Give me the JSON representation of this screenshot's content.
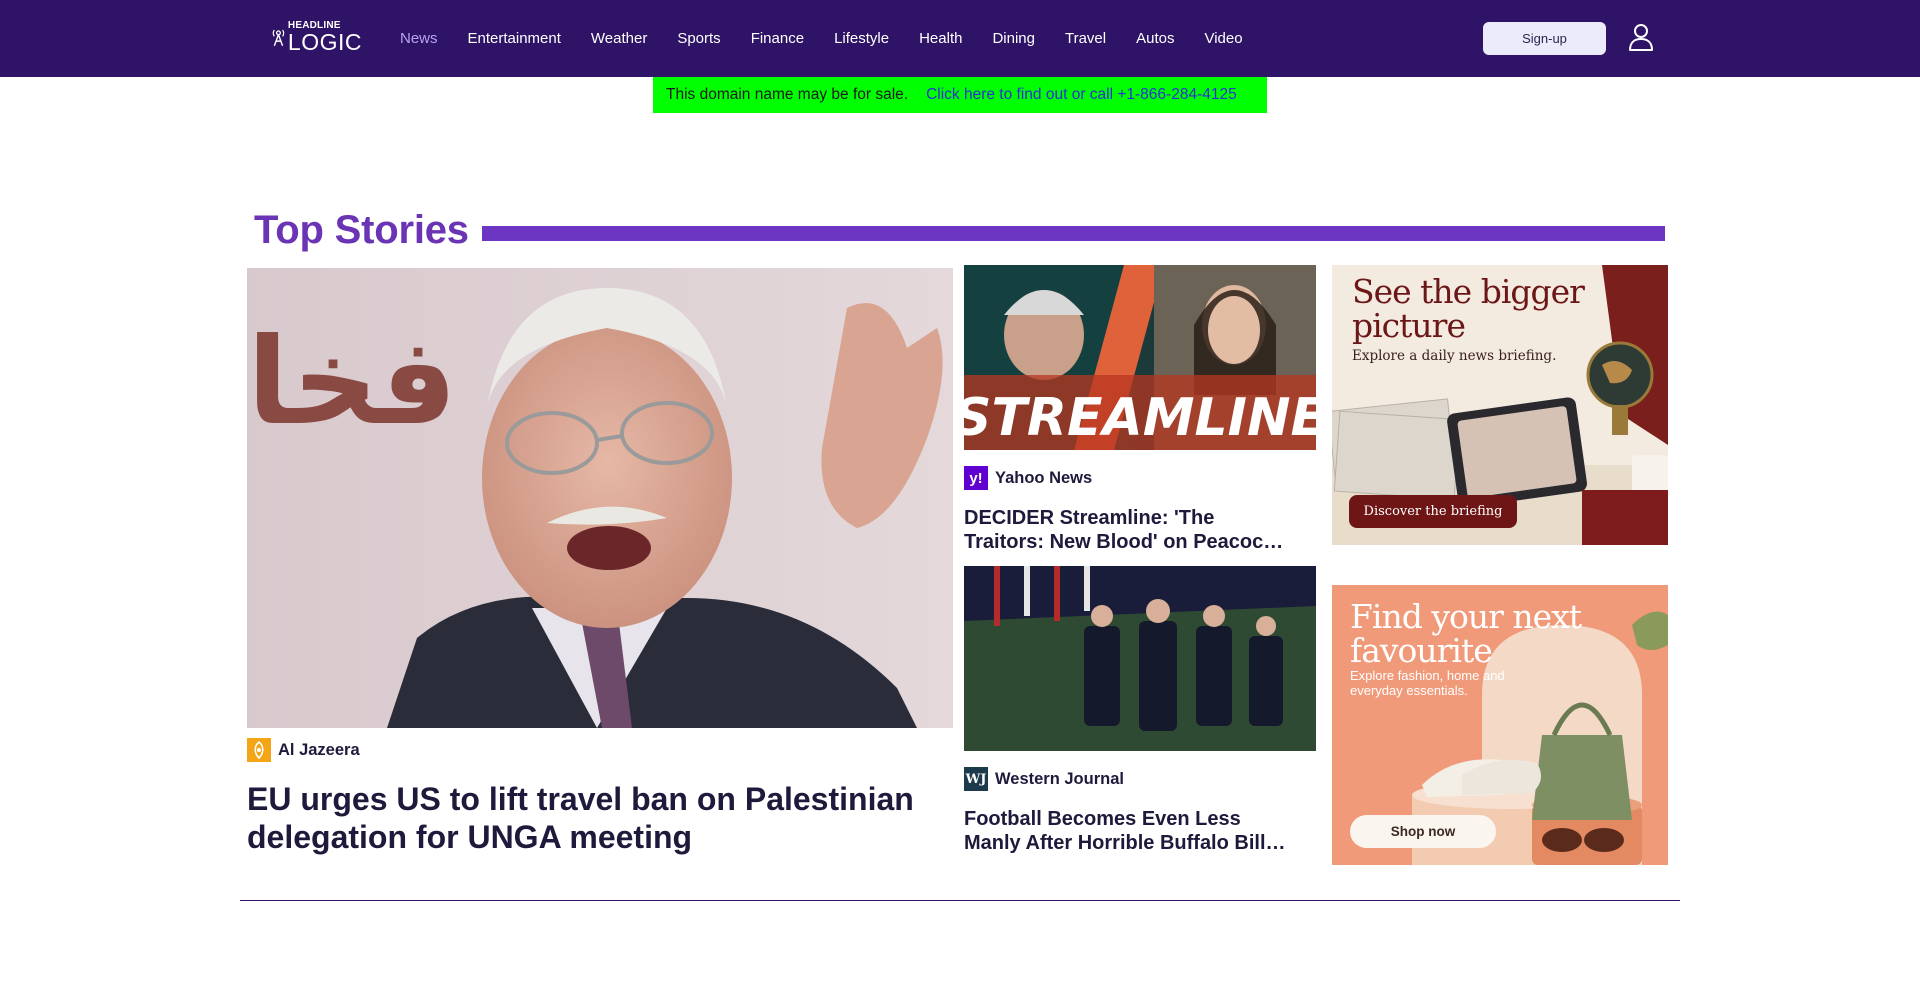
{
  "header": {
    "logo_top": "HEADLINE",
    "logo_bottom": "LOGIC",
    "nav": [
      "News",
      "Entertainment",
      "Weather",
      "Sports",
      "Finance",
      "Lifestyle",
      "Health",
      "Dining",
      "Travel",
      "Autos",
      "Video"
    ],
    "active_nav": "News",
    "signup_label": "Sign-up",
    "background_color": "#2e1366",
    "active_color": "#b8a4f2"
  },
  "banner": {
    "text": "This domain name may be for sale.",
    "link": "Click here to find out or call +1-866-284-4125",
    "background_color": "#00ff00"
  },
  "section": {
    "title": "Top Stories",
    "accent_color": "#6a34b5"
  },
  "stories": {
    "main": {
      "source": "Al Jazeera",
      "headline": "EU urges US to lift travel ban on Palestinian delegation for UNGA meeting",
      "image_text": "فخا"
    },
    "side": [
      {
        "source": "Yahoo News",
        "headline_line1": "DECIDER Streamline: 'The",
        "headline_line2": "Traitors: New Blood' on Peacoc…",
        "image_text": "STREAMLINE"
      },
      {
        "source": "Western Journal",
        "headline_line1": "Football Becomes Even Less",
        "headline_line2": "Manly After Horrible Buffalo Bill…"
      }
    ]
  },
  "ads": [
    {
      "title_line1": "See the bigger",
      "title_line2": "picture",
      "subtitle": "Explore a daily news briefing.",
      "button": "Discover the briefing"
    },
    {
      "title_line1": "Find your next",
      "title_line2": "favourite",
      "subtitle_line1": "Explore fashion, home and",
      "subtitle_line2": "everyday essentials.",
      "button": "Shop now"
    }
  ]
}
